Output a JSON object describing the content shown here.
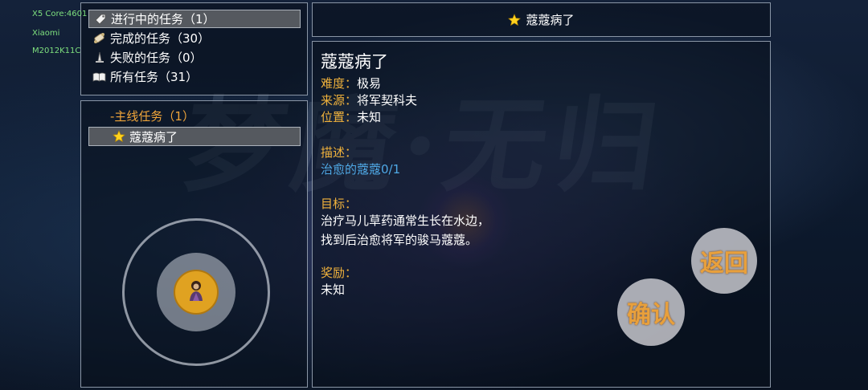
{
  "debug": {
    "line1": "X5 Core:4601",
    "line2": "Xiaomi",
    "line3": "M2012K11C"
  },
  "categories": [
    {
      "label": "进行中的任务（1）",
      "icon": "tag-icon",
      "selected": true
    },
    {
      "label": "完成的任务（30）",
      "icon": "scroll-icon",
      "selected": false
    },
    {
      "label": "失败的任务（0）",
      "icon": "broken-sword-icon",
      "selected": false
    },
    {
      "label": "所有任务（31）",
      "icon": "book-icon",
      "selected": false
    }
  ],
  "quest_list": {
    "group_label": "-主线任务（1）",
    "items": [
      {
        "label": "蔻蔻病了",
        "icon": "star-icon",
        "selected": true
      }
    ]
  },
  "header": {
    "title": "蔻蔻病了",
    "icon": "star-icon"
  },
  "detail": {
    "title": "蔻蔻病了",
    "difficulty_label": "难度：",
    "difficulty_value": "极易",
    "source_label": "来源：",
    "source_value": "将军契科夫",
    "location_label": "位置：",
    "location_value": "未知",
    "description_label": "描述：",
    "description_value": "治愈的蔻蔻0/1",
    "objective_label": "目标：",
    "objective_line1": "治疗马儿草药通常生长在水边，",
    "objective_line2": "找到后治愈将军的骏马蔻蔻。",
    "reward_label": "奖励：",
    "reward_value": "未知"
  },
  "buttons": {
    "back": "返回",
    "confirm": "确认"
  },
  "background_art_text": "梦魔·无归",
  "colors": {
    "accent_label": "#f0b23c",
    "link": "#4fa9e6",
    "selection": "#55595f",
    "joystick_knob": "#e0a221"
  }
}
